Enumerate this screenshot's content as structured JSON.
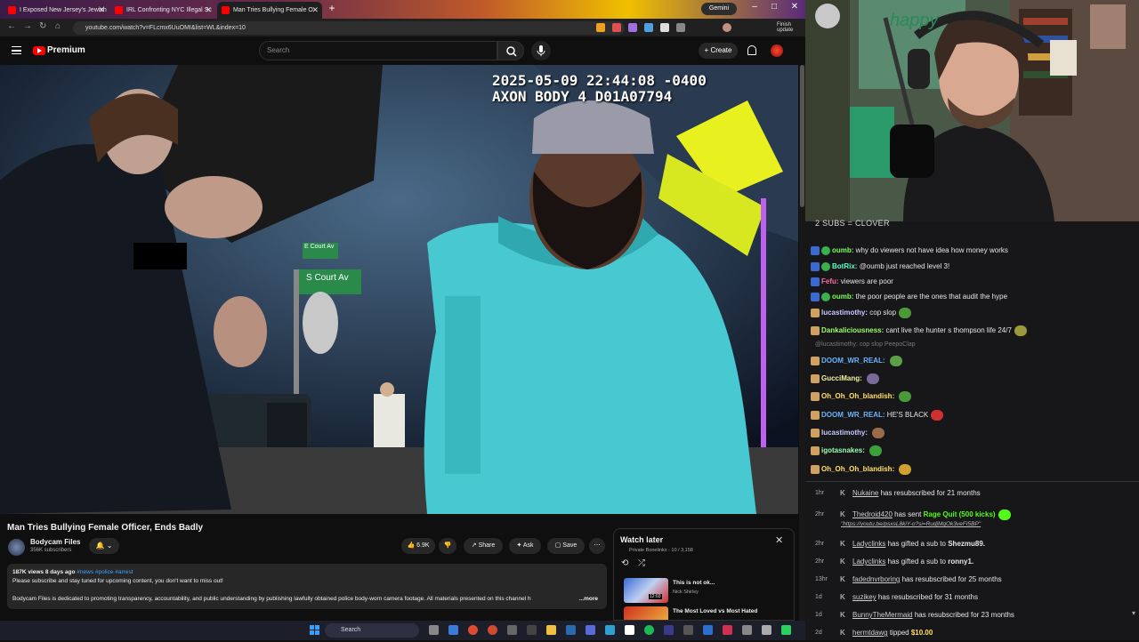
{
  "browser": {
    "tabs": [
      {
        "label": "I Exposed New Jersey's Jewish"
      },
      {
        "label": "IRL Confronting NYC Illegal Sc"
      },
      {
        "label": "Man Tries Bullying Female O"
      }
    ],
    "gemini_label": "Gemini",
    "url": "youtube.com/watch?v=FLcmx6UuOMI&list=WL&index=10",
    "update_label": "Finish update"
  },
  "youtube": {
    "brand": "Premium",
    "search_placeholder": "Search",
    "create_label": "Create",
    "video": {
      "overlay_line1": "2025-05-09 22:44:08 -0400",
      "overlay_line2": "AXON BODY 4 D01A07794",
      "sign1": "E Court Av",
      "sign2": "S Court Av",
      "title": "Man Tries Bullying Female Officer, Ends Badly",
      "channel": "Bodycam Files",
      "subscribers": "356K subscribers",
      "likes": "6.9K",
      "share_label": "Share",
      "ask_label": "Ask",
      "save_label": "Save",
      "views_date": "187K views  8 days ago",
      "hashtags": "#news #police #arrest",
      "desc_line1": "Please subscribe and stay tuned for upcoming content, you don't want to miss out!",
      "desc_line2": "Bodycam Files is dedicated to promoting transparency, accountability, and public understanding by publishing lawfully obtained police body-worn camera footage. All materials presented on this channel h",
      "more_label": "...more"
    },
    "watch_later": {
      "title": "Watch later",
      "meta": "Private  Bonelinks - 10 / 3,158",
      "items": [
        {
          "title": "This is not ok...",
          "author": "Nick Shirley",
          "duration": "12:03"
        },
        {
          "title": "The Most Loved vs Most Hated",
          "author": ""
        }
      ]
    }
  },
  "taskbar": {
    "search_label": "Search"
  },
  "stream": {
    "banner": "2 SUBS = CLOVER",
    "cam_sign": "happy"
  },
  "chat": {
    "messages": [
      {
        "user": "oumb:",
        "text": "why do viewers not have idea how money works",
        "color": "#7cff5a"
      },
      {
        "user": "BotRix:",
        "text": "@oumb just reached level 3!",
        "color": "#5affc8"
      },
      {
        "user": "Fefu:",
        "text": "viewers are poor",
        "color": "#ff6aa0"
      },
      {
        "user": "oumb:",
        "text": "the poor people are the ones that audit the hype",
        "color": "#7cff5a"
      },
      {
        "user": "lucastimothy:",
        "text": "cop slop",
        "color": "#c8c8ff"
      },
      {
        "user": "Dankaliciousness:",
        "text": "cant live the hunter s thompson life 24/7",
        "color": "#9aff6a"
      },
      {
        "user": "DOOM_WR_REAL:",
        "text": "",
        "color": "#6ab4ff"
      },
      {
        "user": "GucciMang:",
        "text": "",
        "color": "#f0f0a0"
      },
      {
        "user": "Oh_Oh_Oh_blandish:",
        "text": "",
        "color": "#ffe066"
      },
      {
        "user": "DOOM_WR_REAL:",
        "text": "HE'S BLACK",
        "color": "#6ab4ff"
      },
      {
        "user": "lucastimothy:",
        "text": "",
        "color": "#c8c8ff"
      },
      {
        "user": "igotasnakes:",
        "text": "",
        "color": "#9affb0"
      },
      {
        "user": "Oh_Oh_Oh_blandish:",
        "text": "",
        "color": "#ffe066"
      }
    ],
    "reply": "@lucastimothy: cop slop PeepoClap",
    "events": [
      {
        "time": "1hr",
        "user": "Nukaine",
        "text": "has resubscribed for 21 months"
      },
      {
        "time": "2hr",
        "user": "Thedroid420",
        "text": "has sent",
        "extra": "Rage Quit (500 kicks)"
      },
      {
        "time": "2hr",
        "user": "Ladyclinks",
        "text": "has gifted a sub to",
        "target": "Shezmu89."
      },
      {
        "time": "2hr",
        "user": "Ladyclinks",
        "text": "has gifted a sub to",
        "target": "ronny1."
      },
      {
        "time": "13hr",
        "user": "fadednvrboring",
        "text": "has resubscribed for 25 months"
      },
      {
        "time": "1d",
        "user": "suzikey",
        "text": "has resubscribed for 31 months"
      },
      {
        "time": "1d",
        "user": "BunnyTheMermaid",
        "text": "has resubscribed for 23 months"
      },
      {
        "time": "2d",
        "user": "hermtdawg",
        "text": "tipped",
        "target": "$10.00"
      }
    ],
    "event_link": "\"https://youtu.be/psxsL8kiY-o?si=RudjMqOk3veFI5BP\""
  }
}
